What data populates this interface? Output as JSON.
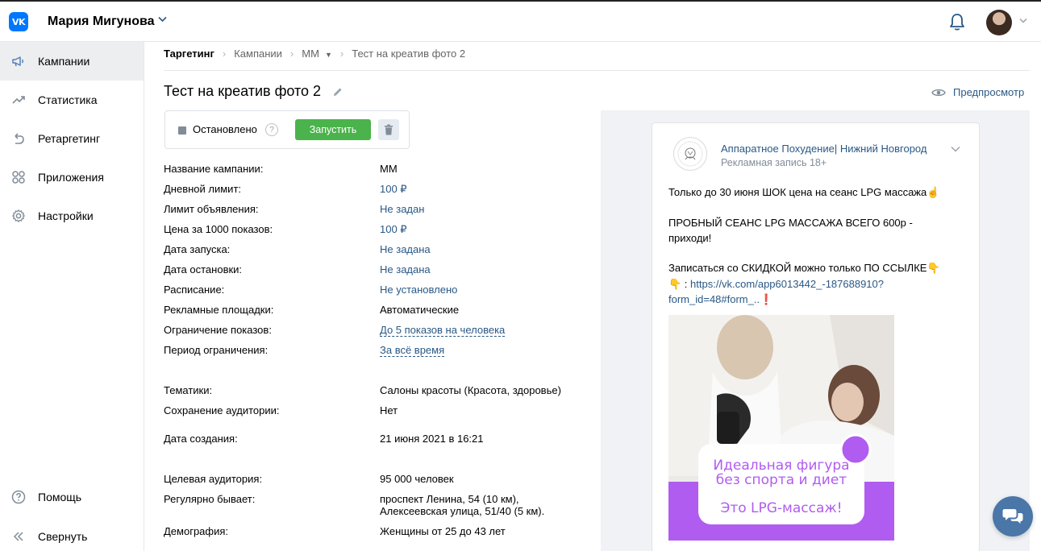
{
  "header": {
    "logo": "VK",
    "user_name": "Мария Мигунова",
    "icons": [
      "vk-logo",
      "chevron-down-icon",
      "bell-icon",
      "avatar",
      "chevron-down-icon"
    ]
  },
  "sidebar": {
    "items": [
      {
        "label": "Кампании",
        "icon": "megaphone-icon",
        "active": true
      },
      {
        "label": "Статистика",
        "icon": "chart-icon"
      },
      {
        "label": "Ретаргетинг",
        "icon": "retarget-icon"
      },
      {
        "label": "Приложения",
        "icon": "apps-icon"
      },
      {
        "label": "Настройки",
        "icon": "gear-icon"
      }
    ],
    "bottom": [
      {
        "label": "Помощь",
        "icon": "help-icon"
      },
      {
        "label": "Свернуть",
        "icon": "collapse-icon"
      }
    ]
  },
  "breadcrumb": {
    "items": [
      "Таргетинг",
      "Кампании",
      "ММ",
      "Тест на креатив фото 2"
    ]
  },
  "page": {
    "title": "Тест на креатив фото 2",
    "preview_label": "Предпросмотр",
    "status": "Остановлено",
    "help_symbol": "?",
    "launch_label": "Запустить"
  },
  "info": [
    {
      "label": "Название кампании:",
      "value": "ММ",
      "style": "plain"
    },
    {
      "label": "Дневной лимит:",
      "value": "100 ₽",
      "style": "link"
    },
    {
      "label": "Лимит объявления:",
      "value": "Не задан",
      "style": "link"
    },
    {
      "label": "Цена за 1000 показов:",
      "value": "100 ₽",
      "style": "link"
    },
    {
      "label": "Дата запуска:",
      "value": "Не задана",
      "style": "link"
    },
    {
      "label": "Дата остановки:",
      "value": "Не задана",
      "style": "link"
    },
    {
      "label": "Расписание:",
      "value": "Не установлено",
      "style": "link"
    },
    {
      "label": "Рекламные площадки:",
      "value": "Автоматические",
      "style": "plain"
    },
    {
      "label": "Ограничение показов:",
      "value": "До 5 показов на человека",
      "style": "dashed"
    },
    {
      "label": "Период ограничения:",
      "value": "За всё время",
      "style": "dashed"
    },
    {
      "label": "Тематики:",
      "value": "Салоны красоты (Красота, здоровье)",
      "style": "plain"
    },
    {
      "label": "Сохранение аудитории:",
      "value": "Нет",
      "style": "plain"
    },
    {
      "label": "Дата создания:",
      "value": "21 июня 2021 в 16:21",
      "style": "plain"
    },
    {
      "label": "Целевая аудитория:",
      "value": "95 000 человек",
      "style": "plain"
    },
    {
      "label": "Регулярно бывает:",
      "value": "проспект Ленина, 54 (10 км),",
      "value2": "Алексеевская улица, 51/40 (5 км).",
      "style": "plain"
    },
    {
      "label": "Демография:",
      "value": "Женщины от 25 до 43 лет",
      "style": "plain"
    }
  ],
  "post": {
    "author": "Аппаратное Похудение| Нижний Новгород",
    "subtitle": "Рекламная запись 18+",
    "line1": "Только до 30 июня ШОК цена на сеанс LPG массажа☝",
    "line2": "ПРОБНЫЙ СЕАНС LPG МАССАЖА ВСЕГО 600р -",
    "line3": "приходи!",
    "line4": "Записаться со СКИДКОЙ можно только ПО ССЫЛКЕ👇",
    "line5_prefix": "👇 : ",
    "link1": "https://vk.com/app6013442_-187688910?",
    "link2": "form_id=48#form_..",
    "link_suffix": "❗",
    "image_text1": "Идеальная фигура",
    "image_text2": "без спорта и диет",
    "image_text3": "Это LPG-массаж!"
  },
  "colors": {
    "accent": "#2a5885",
    "vk_blue": "#0077ff",
    "green": "#4bb34b",
    "purple": "#b05cf0"
  }
}
